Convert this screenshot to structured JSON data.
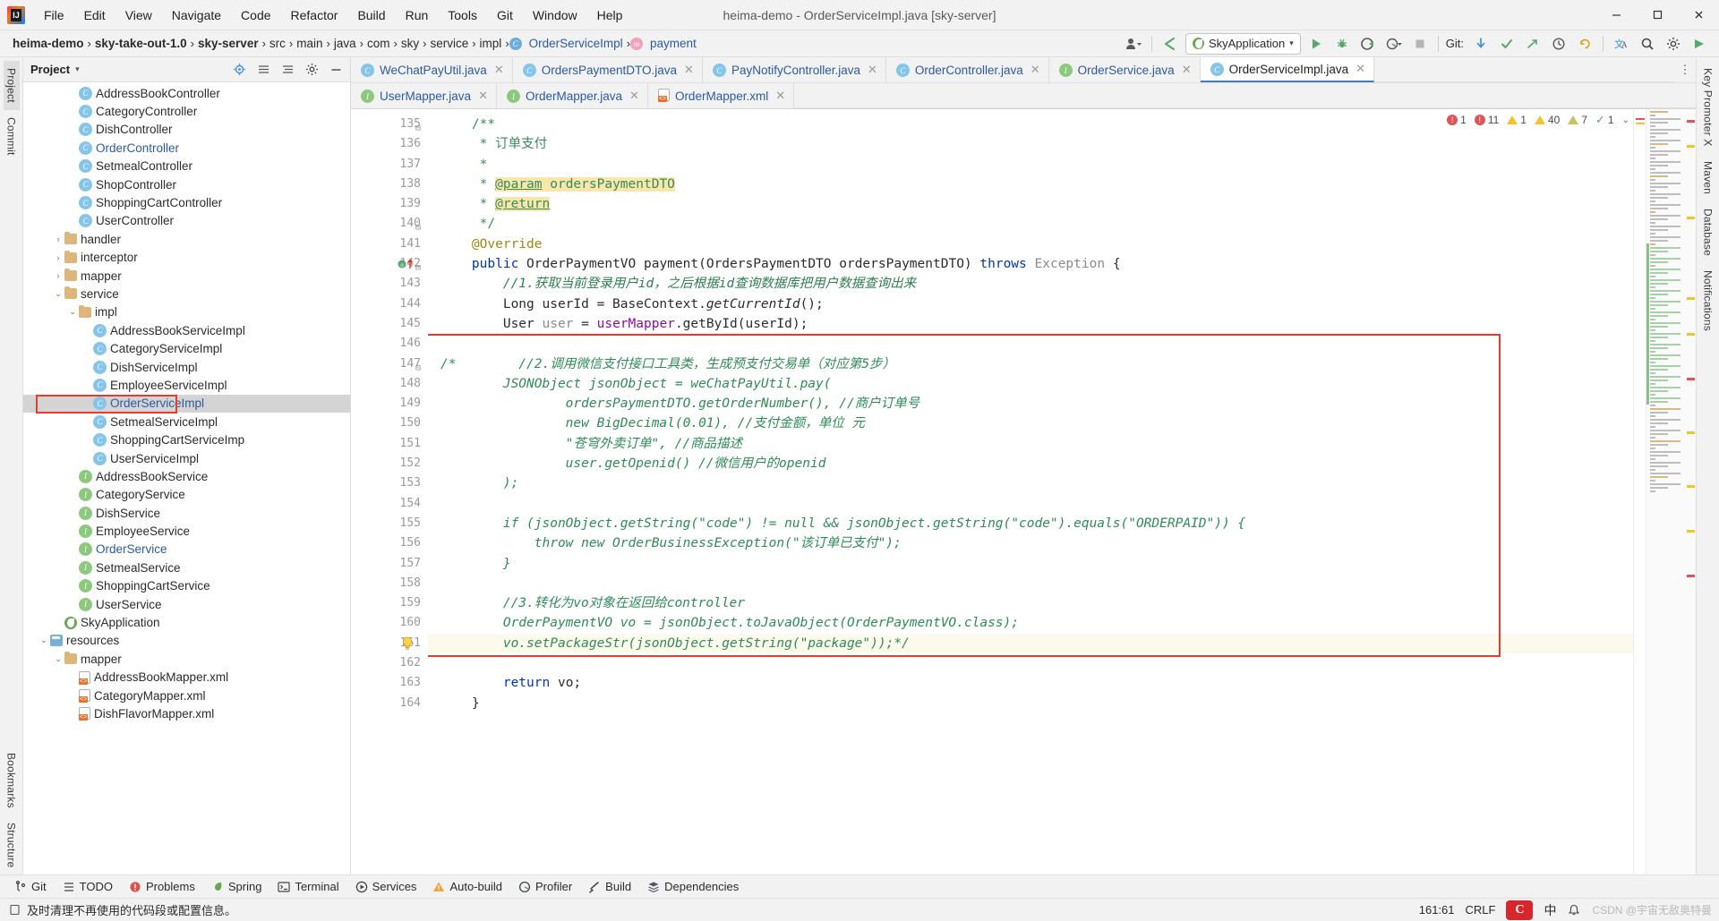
{
  "window": {
    "title": "heima-demo - OrderServiceImpl.java [sky-server]",
    "minimize": "—",
    "maximize": "▢",
    "close": "✕"
  },
  "menu": {
    "items": [
      "File",
      "Edit",
      "View",
      "Navigate",
      "Code",
      "Refactor",
      "Build",
      "Run",
      "Tools",
      "Git",
      "Window",
      "Help"
    ]
  },
  "breadcrumb": {
    "items": [
      {
        "label": "heima-demo",
        "style": "bold"
      },
      {
        "label": "sky-take-out-1.0",
        "style": "bold"
      },
      {
        "label": "sky-server",
        "style": "bold"
      },
      {
        "label": "src",
        "style": "plain"
      },
      {
        "label": "main",
        "style": "plain"
      },
      {
        "label": "java",
        "style": "plain"
      },
      {
        "label": "com",
        "style": "plain"
      },
      {
        "label": "sky",
        "style": "plain"
      },
      {
        "label": "service",
        "style": "plain"
      },
      {
        "label": "impl",
        "style": "plain"
      },
      {
        "label": "OrderServiceImpl",
        "style": "blue",
        "icon": "c"
      },
      {
        "label": "payment",
        "style": "blue",
        "icon": "m"
      }
    ],
    "separator": "›"
  },
  "toolbar": {
    "run_config": "SkyApplication",
    "run_config_chevron": "▾",
    "git_label": "Git:",
    "icons": {
      "profile": "profile-icon",
      "back_arrow": "back-arrow-icon",
      "run": "run-icon",
      "debug": "debug-icon",
      "coverage": "run-with-coverage-icon",
      "profiler": "profiler-icon",
      "stop": "stop-icon",
      "git_update": "git-update-icon",
      "git_commit": "git-commit-icon",
      "git_push": "git-push-icon",
      "git_history": "git-history-icon",
      "git_rollback": "git-rollback-icon",
      "translate": "translate-icon",
      "search": "search-icon",
      "settings": "settings-icon",
      "search_everywhere": "search-everywhere-icon"
    }
  },
  "left_rail": {
    "items": [
      "Project",
      "Commit",
      "Bookmarks",
      "Structure"
    ]
  },
  "right_rail": {
    "items": [
      "Key Promoter X",
      "Maven",
      "Database",
      "Notifications"
    ]
  },
  "project_pane": {
    "title": "Project",
    "chevron": "▾",
    "toolbar_icons": [
      "locate-icon",
      "collapse-all-icon",
      "expand-all-icon",
      "settings-icon",
      "hide-icon"
    ],
    "tree": [
      {
        "indent": 3,
        "icon": "class-c",
        "label": "AddressBookController",
        "color": "black",
        "arrow": ""
      },
      {
        "indent": 3,
        "icon": "class-c",
        "label": "CategoryController",
        "color": "black",
        "arrow": ""
      },
      {
        "indent": 3,
        "icon": "class-c",
        "label": "DishController",
        "color": "black",
        "arrow": ""
      },
      {
        "indent": 3,
        "icon": "class-c",
        "label": "OrderController",
        "color": "blue",
        "arrow": ""
      },
      {
        "indent": 3,
        "icon": "class-c",
        "label": "SetmealController",
        "color": "black",
        "arrow": ""
      },
      {
        "indent": 3,
        "icon": "class-c",
        "label": "ShopController",
        "color": "black",
        "arrow": ""
      },
      {
        "indent": 3,
        "icon": "class-c",
        "label": "ShoppingCartController",
        "color": "black",
        "arrow": ""
      },
      {
        "indent": 3,
        "icon": "class-c",
        "label": "UserController",
        "color": "black",
        "arrow": ""
      },
      {
        "indent": 2,
        "icon": "folder",
        "label": "handler",
        "color": "black",
        "arrow": "›"
      },
      {
        "indent": 2,
        "icon": "folder",
        "label": "interceptor",
        "color": "black",
        "arrow": "›"
      },
      {
        "indent": 2,
        "icon": "folder",
        "label": "mapper",
        "color": "black",
        "arrow": "›"
      },
      {
        "indent": 2,
        "icon": "folder",
        "label": "service",
        "color": "black",
        "arrow": "⌄"
      },
      {
        "indent": 3,
        "icon": "folder",
        "label": "impl",
        "color": "black",
        "arrow": "⌄"
      },
      {
        "indent": 4,
        "icon": "class-c",
        "label": "AddressBookServiceImpl",
        "color": "black",
        "arrow": ""
      },
      {
        "indent": 4,
        "icon": "class-c",
        "label": "CategoryServiceImpl",
        "color": "black",
        "arrow": ""
      },
      {
        "indent": 4,
        "icon": "class-c",
        "label": "DishServiceImpl",
        "color": "black",
        "arrow": ""
      },
      {
        "indent": 4,
        "icon": "class-c",
        "label": "EmployeeServiceImpl",
        "color": "black",
        "arrow": ""
      },
      {
        "indent": 4,
        "icon": "class-c",
        "label": "OrderServiceImpl",
        "color": "blue",
        "arrow": "",
        "selected": true
      },
      {
        "indent": 4,
        "icon": "class-c",
        "label": "SetmealServiceImpl",
        "color": "black",
        "arrow": ""
      },
      {
        "indent": 4,
        "icon": "class-c",
        "label": "ShoppingCartServiceImp",
        "color": "black",
        "arrow": ""
      },
      {
        "indent": 4,
        "icon": "class-c",
        "label": "UserServiceImpl",
        "color": "black",
        "arrow": ""
      },
      {
        "indent": 3,
        "icon": "iface-i",
        "label": "AddressBookService",
        "color": "black",
        "arrow": ""
      },
      {
        "indent": 3,
        "icon": "iface-i",
        "label": "CategoryService",
        "color": "black",
        "arrow": ""
      },
      {
        "indent": 3,
        "icon": "iface-i",
        "label": "DishService",
        "color": "black",
        "arrow": ""
      },
      {
        "indent": 3,
        "icon": "iface-i",
        "label": "EmployeeService",
        "color": "black",
        "arrow": ""
      },
      {
        "indent": 3,
        "icon": "iface-i",
        "label": "OrderService",
        "color": "blue",
        "arrow": ""
      },
      {
        "indent": 3,
        "icon": "iface-i",
        "label": "SetmealService",
        "color": "black",
        "arrow": ""
      },
      {
        "indent": 3,
        "icon": "iface-i",
        "label": "ShoppingCartService",
        "color": "black",
        "arrow": ""
      },
      {
        "indent": 3,
        "icon": "iface-i",
        "label": "UserService",
        "color": "black",
        "arrow": ""
      },
      {
        "indent": 2,
        "icon": "spring",
        "label": "SkyApplication",
        "color": "black",
        "arrow": ""
      },
      {
        "indent": 1,
        "icon": "res",
        "label": "resources",
        "color": "black",
        "arrow": "⌄"
      },
      {
        "indent": 2,
        "icon": "folder",
        "label": "mapper",
        "color": "black",
        "arrow": "⌄"
      },
      {
        "indent": 3,
        "icon": "xml",
        "label": "AddressBookMapper.xml",
        "color": "black",
        "arrow": ""
      },
      {
        "indent": 3,
        "icon": "xml",
        "label": "CategoryMapper.xml",
        "color": "black",
        "arrow": ""
      },
      {
        "indent": 3,
        "icon": "xml",
        "label": "DishFlavorMapper.xml",
        "color": "black",
        "arrow": ""
      }
    ]
  },
  "editor_tabs": {
    "row1": [
      {
        "label": "WeChatPayUtil.java",
        "icon": "class-c",
        "active": false,
        "close": "✕"
      },
      {
        "label": "OrdersPaymentDTO.java",
        "icon": "class-c",
        "active": false,
        "close": "✕"
      },
      {
        "label": "PayNotifyController.java",
        "icon": "class-c",
        "active": false,
        "close": "✕"
      },
      {
        "label": "OrderController.java",
        "icon": "class-c",
        "active": false,
        "close": "✕"
      },
      {
        "label": "OrderService.java",
        "icon": "iface-i",
        "active": false,
        "close": "✕"
      },
      {
        "label": "OrderServiceImpl.java",
        "icon": "class-c",
        "active": true,
        "close": "✕"
      }
    ],
    "row2": [
      {
        "label": "UserMapper.java",
        "icon": "iface-i",
        "active": false,
        "close": "✕"
      },
      {
        "label": "OrderMapper.java",
        "icon": "iface-i",
        "active": false,
        "close": "✕"
      },
      {
        "label": "OrderMapper.xml",
        "icon": "xml",
        "active": false,
        "close": "✕"
      }
    ],
    "more": "⋮"
  },
  "inspections": {
    "errors": "1",
    "error_sub": "11",
    "warnings_a": "1",
    "warnings_b": "40",
    "weak": "7",
    "typos": "1",
    "chevron": "⌄"
  },
  "code": {
    "first_line": 135,
    "lines": [
      {
        "n": 135,
        "fold": "⊟",
        "text": "    /**",
        "cls": "cm-doc"
      },
      {
        "n": 136,
        "fold": "",
        "text": "     * 订单支付",
        "cls": "cm-doc"
      },
      {
        "n": 137,
        "fold": "",
        "text": "     *",
        "cls": "cm-doc"
      },
      {
        "n": 138,
        "fold": "",
        "text": "     * @param ordersPaymentDTO",
        "cls": "cm-doc",
        "kind": "param"
      },
      {
        "n": 139,
        "fold": "",
        "text": "     * @return",
        "cls": "cm-doc",
        "kind": "return"
      },
      {
        "n": 140,
        "fold": "⊟",
        "text": "     */",
        "cls": "cm-doc"
      },
      {
        "n": 141,
        "fold": "",
        "text": "    @Override",
        "cls": "anno"
      },
      {
        "n": 142,
        "fold": "⊟",
        "text": "    public OrderPaymentVO payment(OrdersPaymentDTO ordersPaymentDTO) throws Exception {",
        "cls": "sig",
        "marker": "override"
      },
      {
        "n": 143,
        "fold": "",
        "text": "        //1.获取当前登录用户id，之后根据id查询数据库把用户数据查询出来",
        "cls": "cm"
      },
      {
        "n": 144,
        "fold": "",
        "text": "        Long userId = BaseContext.getCurrentId();",
        "cls": "code1"
      },
      {
        "n": 145,
        "fold": "",
        "text": "        User user = userMapper.getById(userId);",
        "cls": "code2"
      },
      {
        "n": 146,
        "fold": "",
        "text": "",
        "cls": ""
      },
      {
        "n": 147,
        "fold": "⊟",
        "text": "/*        //2.调用微信支付接口工具类，生成预支付交易单（对应第5步）",
        "cls": "cmblk"
      },
      {
        "n": 148,
        "fold": "",
        "text": "        JSONObject jsonObject = weChatPayUtil.pay(",
        "cls": "cmblk"
      },
      {
        "n": 149,
        "fold": "",
        "text": "                ordersPaymentDTO.getOrderNumber(), //商户订单号",
        "cls": "cmblk"
      },
      {
        "n": 150,
        "fold": "",
        "text": "                new BigDecimal(0.01), //支付金额，单位 元",
        "cls": "cmblk"
      },
      {
        "n": 151,
        "fold": "",
        "text": "                \"苍穹外卖订单\", //商品描述",
        "cls": "cmblk"
      },
      {
        "n": 152,
        "fold": "",
        "text": "                user.getOpenid() //微信用户的openid",
        "cls": "cmblk"
      },
      {
        "n": 153,
        "fold": "",
        "text": "        );",
        "cls": "cmblk"
      },
      {
        "n": 154,
        "fold": "",
        "text": "",
        "cls": "cmblk"
      },
      {
        "n": 155,
        "fold": "",
        "text": "        if (jsonObject.getString(\"code\") != null && jsonObject.getString(\"code\").equals(\"ORDERPAID\")) {",
        "cls": "cmblk"
      },
      {
        "n": 156,
        "fold": "",
        "text": "            throw new OrderBusinessException(\"该订单已支付\");",
        "cls": "cmblk"
      },
      {
        "n": 157,
        "fold": "",
        "text": "        }",
        "cls": "cmblk"
      },
      {
        "n": 158,
        "fold": "",
        "text": "",
        "cls": "cmblk"
      },
      {
        "n": 159,
        "fold": "",
        "text": "        //3.转化为vo对象在返回给controller",
        "cls": "cmblk"
      },
      {
        "n": 160,
        "fold": "",
        "text": "        OrderPaymentVO vo = jsonObject.toJavaObject(OrderPaymentVO.class);",
        "cls": "cmblk"
      },
      {
        "n": 161,
        "fold": "",
        "text": "        vo.setPackageStr(jsonObject.getString(\"package\"));*/",
        "cls": "cmblk",
        "bulb": true,
        "current": true
      },
      {
        "n": 162,
        "fold": "",
        "text": "",
        "cls": ""
      },
      {
        "n": 163,
        "fold": "",
        "text": "        return vo;",
        "cls": "ret"
      },
      {
        "n": 164,
        "fold": "",
        "text": "    }",
        "cls": ""
      }
    ]
  },
  "bottom_tools": [
    {
      "label": "Git",
      "icon": "git-icon"
    },
    {
      "label": "TODO",
      "icon": "todo-icon"
    },
    {
      "label": "Problems",
      "icon": "problems-icon"
    },
    {
      "label": "Spring",
      "icon": "spring-icon"
    },
    {
      "label": "Terminal",
      "icon": "terminal-icon"
    },
    {
      "label": "Services",
      "icon": "services-icon"
    },
    {
      "label": "Auto-build",
      "icon": "auto-build-icon"
    },
    {
      "label": "Profiler",
      "icon": "profiler-icon"
    },
    {
      "label": "Build",
      "icon": "build-icon"
    },
    {
      "label": "Dependencies",
      "icon": "dependencies-icon"
    }
  ],
  "status_bar": {
    "message": "及时清理不再使用的代码段或配置信息。",
    "caret": "161:61",
    "line_sep": "CRLF",
    "lang": "中",
    "watermark": "CSDN @宇宙无敌奥特曼"
  },
  "colors": {
    "accent_blue": "#2c5aa0",
    "red_highlight": "#e33d2e",
    "green_run": "#59a869",
    "comment_green": "#2e7d4f"
  }
}
